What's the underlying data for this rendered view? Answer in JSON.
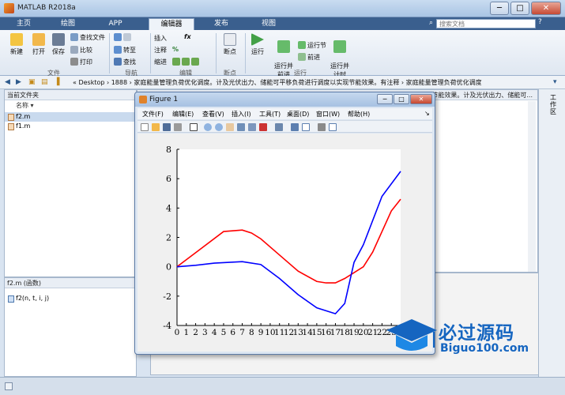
{
  "app": {
    "title": "MATLAB R2018a"
  },
  "window": {
    "minimize": "─",
    "maximize": "□",
    "close": "✕"
  },
  "tabs": [
    {
      "label": "主页"
    },
    {
      "label": "绘图"
    },
    {
      "label": "APP"
    },
    {
      "label": "编辑器"
    },
    {
      "label": "发布"
    },
    {
      "label": "视图"
    }
  ],
  "search": {
    "placeholder": "搜索文档"
  },
  "ribbon": {
    "new": "新建",
    "open": "打开",
    "save": "保存",
    "find_files": "查找文件",
    "compare": "比较",
    "print": "打印",
    "goto": "转至",
    "find": "查找",
    "insert": "插入",
    "comment": "注释",
    "indent": "缩进",
    "fx": "fx",
    "breakpoints": "断点",
    "run": "运行",
    "run_and_advance": "运行并\n前进",
    "run_section": "运行节",
    "advance": "前进",
    "run_and_time": "运行并\n计时",
    "groups": {
      "file": "文件",
      "nav": "导航",
      "edit": "编辑",
      "bp": "断点",
      "run": "运行"
    }
  },
  "address": {
    "path": "«  Desktop  ›  1888  ›  家庭能量管理负荷优化调度。计及光伏出力、储能可平移负荷进行调度以实现节能效果。有注释  ›  家庭能量管理负荷优化调度"
  },
  "current_folder": {
    "header": "当前文件夹",
    "col_name": "名称",
    "files": [
      {
        "name": "f2.m"
      },
      {
        "name": "f1.m"
      }
    ]
  },
  "details": {
    "header": "f2.m  (函数)",
    "item": "f2(n, t, i, j)"
  },
  "editor_behind": {
    "snippet": "实现节能效果。计及光伏出力、储能可..."
  },
  "workspace": {
    "label": "工作区"
  },
  "figure": {
    "title": "Figure 1",
    "menu": [
      "文件(F)",
      "编辑(E)",
      "查看(V)",
      "插入(I)",
      "工具(T)",
      "桌面(D)",
      "窗口(W)",
      "帮助(H)"
    ]
  },
  "chart_data": {
    "type": "line",
    "x": [
      0,
      1,
      2,
      3,
      4,
      5,
      6,
      7,
      8,
      9,
      10,
      11,
      12,
      13,
      14,
      15,
      16,
      17,
      18,
      19,
      20,
      21,
      22,
      23
    ],
    "xtick_labels": [
      "0",
      "1",
      "2",
      "3",
      "4",
      "5",
      "6",
      "7",
      "8",
      "9",
      "10",
      "11",
      "12",
      "13",
      "14",
      "15",
      "16",
      "17",
      "18",
      "19",
      "20",
      "21",
      "22",
      "23"
    ],
    "ylim": [
      -4,
      8
    ],
    "yticks": [
      -4,
      -2,
      0,
      2,
      4,
      6,
      8
    ],
    "series": [
      {
        "color": "#ff0000",
        "points": [
          [
            0,
            0
          ],
          [
            5,
            2.4
          ],
          [
            7,
            2.5
          ],
          [
            8,
            2.3
          ],
          [
            9,
            1.9
          ],
          [
            11,
            0.8
          ],
          [
            13,
            -0.3
          ],
          [
            15,
            -1.0
          ],
          [
            16,
            -1.1
          ],
          [
            17,
            -1.1
          ],
          [
            18,
            -0.8
          ],
          [
            20,
            0
          ],
          [
            21,
            1.0
          ],
          [
            23,
            3.8
          ],
          [
            24,
            4.6
          ]
        ]
      },
      {
        "color": "#0000ff",
        "points": [
          [
            0,
            0
          ],
          [
            2,
            0.1
          ],
          [
            4,
            0.25
          ],
          [
            7,
            0.35
          ],
          [
            9,
            0.15
          ],
          [
            11,
            -0.8
          ],
          [
            13,
            -1.9
          ],
          [
            15,
            -2.8
          ],
          [
            17,
            -3.2
          ],
          [
            18,
            -2.5
          ],
          [
            19,
            0.3
          ],
          [
            20,
            1.5
          ],
          [
            22,
            4.8
          ],
          [
            24,
            6.5
          ]
        ]
      }
    ]
  },
  "watermark": {
    "big": "必过源码",
    "small": "Biguo100.com"
  },
  "colors": {
    "tab_bar": "#3a5f8e",
    "accent": "#1565c0"
  }
}
